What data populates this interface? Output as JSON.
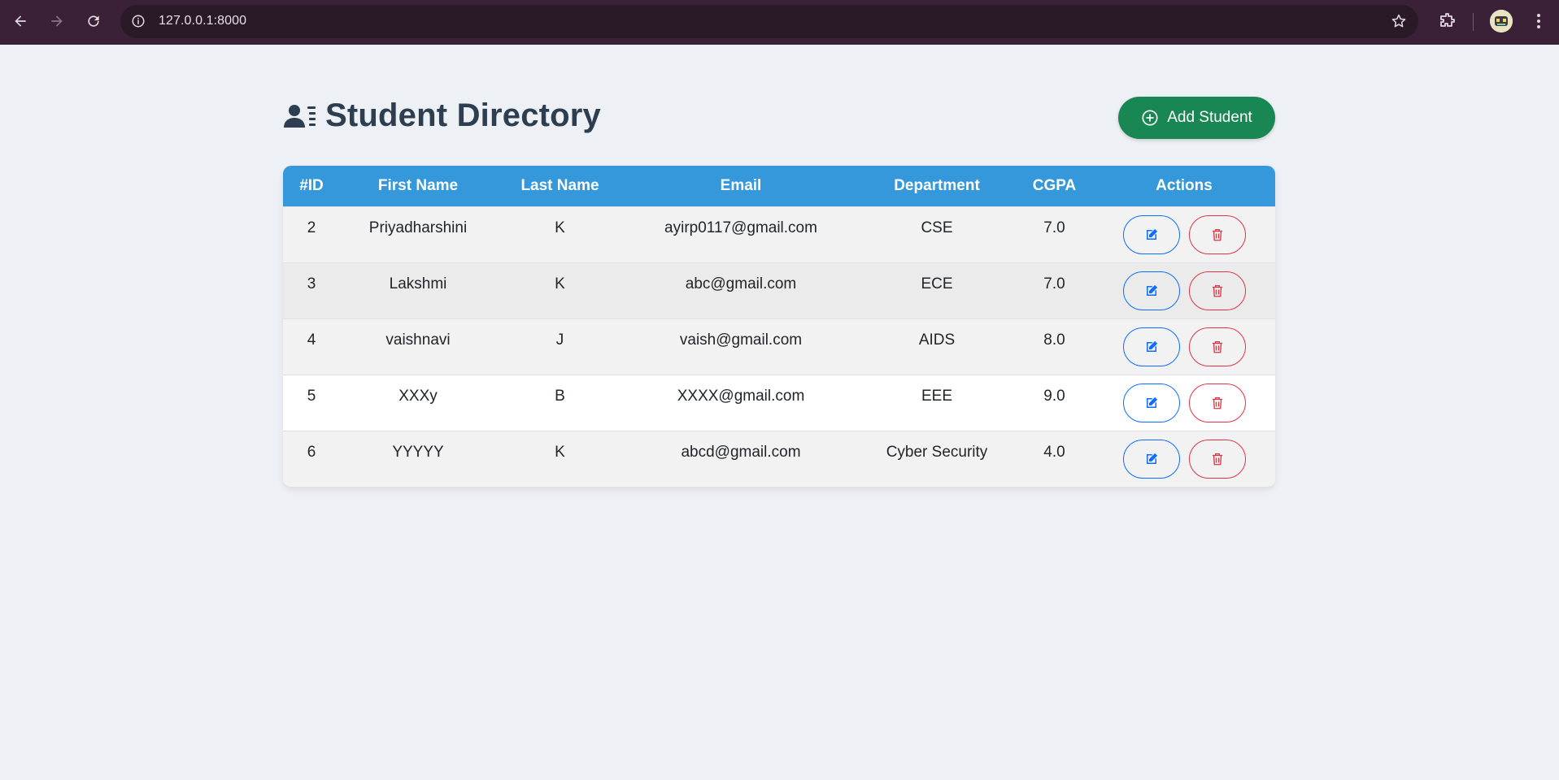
{
  "browser": {
    "url": "127.0.0.1:8000",
    "icons": [
      "back-icon",
      "forward-icon",
      "reload-icon",
      "site-info-icon",
      "bookmark-star-icon",
      "extensions-icon",
      "profile-avatar",
      "menu-kebab-icon"
    ]
  },
  "header": {
    "title": "Student Directory",
    "title_icon": "user-list-icon",
    "add_button_label": "Add Student",
    "add_button_icon": "plus-circle-icon"
  },
  "colors": {
    "accent_header": "#3498db",
    "add_button": "#198754",
    "edit_outline": "#0d6efd",
    "delete_outline": "#dc3545",
    "title_text": "#2c3e50"
  },
  "table": {
    "columns": [
      "#ID",
      "First Name",
      "Last Name",
      "Email",
      "Department",
      "CGPA",
      "Actions"
    ],
    "rows": [
      {
        "id": "2",
        "first_name": "Priyadharshini",
        "last_name": "K",
        "email": "ayirp0117@gmail.com",
        "department": "CSE",
        "cgpa": "7.0"
      },
      {
        "id": "3",
        "first_name": "Lakshmi",
        "last_name": "K",
        "email": "abc@gmail.com",
        "department": "ECE",
        "cgpa": "7.0"
      },
      {
        "id": "4",
        "first_name": "vaishnavi",
        "last_name": "J",
        "email": "vaish@gmail.com",
        "department": "AIDS",
        "cgpa": "8.0"
      },
      {
        "id": "5",
        "first_name": "XXXy",
        "last_name": "B",
        "email": "XXXX@gmail.com",
        "department": "EEE",
        "cgpa": "9.0"
      },
      {
        "id": "6",
        "first_name": "YYYYY",
        "last_name": "K",
        "email": "abcd@gmail.com",
        "department": "Cyber Security",
        "cgpa": "4.0"
      }
    ],
    "row_action_icons": [
      "edit-icon",
      "trash-icon"
    ]
  }
}
